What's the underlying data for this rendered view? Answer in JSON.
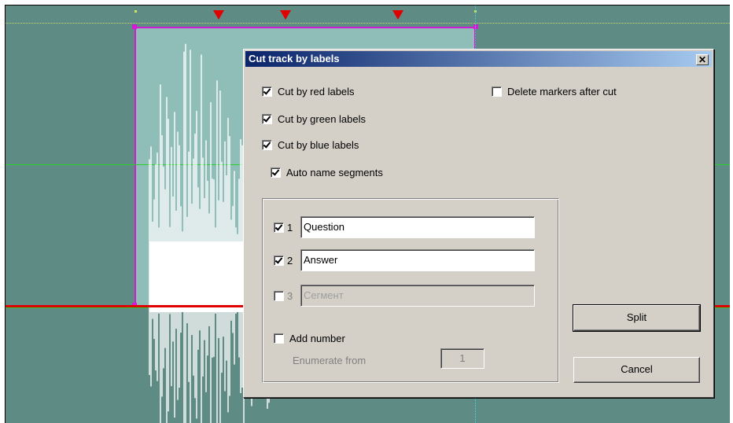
{
  "colors": {
    "track_background": "#5f8b85",
    "selection_fill": "#8fbdb7",
    "selection_border": "#d21cd4",
    "waveform": "#ffffff",
    "label_marker_red": "#e00000",
    "guide_green": "#27d22a",
    "dialog_face": "#d4d0c8",
    "titlebar_start": "#0a246a",
    "titlebar_end": "#a6caf0"
  },
  "editor": {
    "label_markers": [
      "red",
      "red",
      "red"
    ]
  },
  "dialog": {
    "title": "Cut track by labels",
    "close_icon": "close-icon",
    "options": {
      "cut_red": {
        "label": "Cut by red labels",
        "checked": true
      },
      "cut_green": {
        "label": "Cut by green labels",
        "checked": true
      },
      "cut_blue": {
        "label": "Cut by blue labels",
        "checked": true
      },
      "delete_markers": {
        "label": "Delete markers after cut",
        "checked": false
      },
      "auto_name": {
        "label": "Auto name segments",
        "checked": true
      }
    },
    "segments": [
      {
        "number": "1",
        "name": "Question",
        "checked": true,
        "enabled": true
      },
      {
        "number": "2",
        "name": "Answer",
        "checked": true,
        "enabled": true
      },
      {
        "number": "3",
        "name": "Сегмент",
        "checked": false,
        "enabled": false
      }
    ],
    "add_number": {
      "label": "Add number",
      "checked": false
    },
    "enumerate_from": {
      "label": "Enumerate from",
      "value": "1"
    },
    "buttons": {
      "split": "Split",
      "cancel": "Cancel"
    }
  }
}
